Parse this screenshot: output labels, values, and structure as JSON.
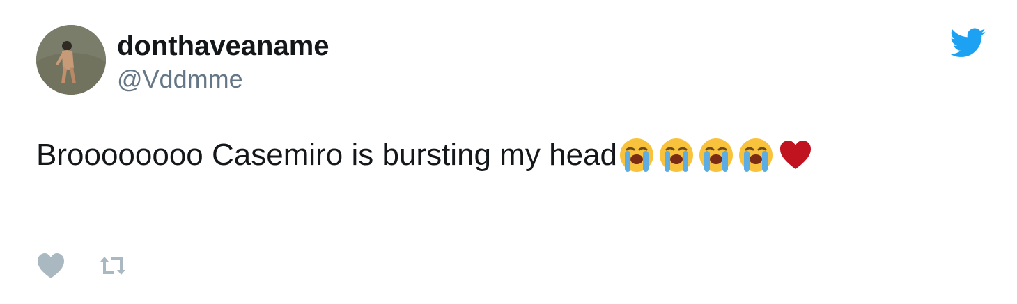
{
  "tweet": {
    "author": {
      "display_name": "donthaveaname",
      "handle": "@Vddmme"
    },
    "text": "Broooooooo Casemiro is bursting my head",
    "emojis": [
      "loudly-crying-face",
      "loudly-crying-face",
      "loudly-crying-face",
      "loudly-crying-face",
      "red-heart"
    ],
    "actions": {
      "like_icon": "heart-icon",
      "retweet_icon": "retweet-icon"
    }
  },
  "colors": {
    "twitter_blue": "#1da1f2",
    "handle_gray": "#657786",
    "action_gray": "#aab8c2",
    "heart_red": "#c1121f",
    "emoji_yellow": "#f9c23c",
    "tear_blue": "#5dade2"
  }
}
